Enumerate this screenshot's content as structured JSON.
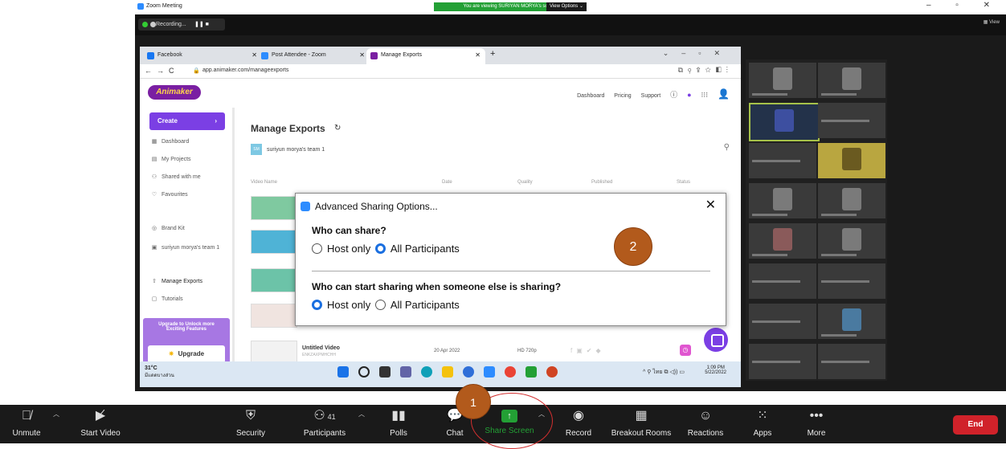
{
  "zoom_window": {
    "title": "Zoom Meeting",
    "viewing_banner": "You are viewing SURIYAN MORYA's screen",
    "view_options": "View Options ⌄",
    "recording_label": "Recording...",
    "rec_controls": "❚❚  ■",
    "view_label": "▦ View",
    "window_controls": "–  ▫  ✕"
  },
  "browser": {
    "tabs": [
      {
        "label": "Facebook",
        "icon_color": "#1877f2"
      },
      {
        "label": "Post Attendee - Zoom",
        "icon_color": "#2d8cff"
      },
      {
        "label": "Manage Exports",
        "icon_color": "#7a1fa2"
      }
    ],
    "tab_close": "✕",
    "new_tab": "+",
    "nav_icons": "←→C",
    "url": "app.animaker.com/manageexports"
  },
  "animaker": {
    "logo_text": "Animaker",
    "nav": [
      "Dashboard",
      "Pricing",
      "Support"
    ],
    "create_label": "Create",
    "sidebar_items": [
      "Dashboard",
      "My Projects",
      "Shared with me",
      "Favourites",
      "Brand Kit",
      "suriyun morya's team 1",
      "Manage Exports",
      "Tutorials"
    ],
    "upgrade_text": "Upgrade to Unlock more Exciting Features",
    "upgrade_button": "Upgrade",
    "page_title": "Manage Exports",
    "team_initials": "SM",
    "team_name": "suriyun morya's team 1",
    "columns": [
      "Video Name",
      "Date",
      "Quality",
      "Published",
      "Status"
    ],
    "last_row": {
      "name": "Untitled Video",
      "sub": "ENKZAXPMHCHH",
      "date": "20 Apr 2022",
      "quality": "HD 720p"
    }
  },
  "taskbar": {
    "temperature": "31°C",
    "weather_text": "มีแดดบางส่วน",
    "tray": "^  ⚲  ไทย  ⧉ ◁)) ▭",
    "time": "1:09 PM",
    "date": "5/22/2022"
  },
  "dialog": {
    "title": "Advanced Sharing Options...",
    "close": "✕",
    "q1": "Who can share?",
    "q1_options": [
      "Host only",
      "All Participants"
    ],
    "q1_selected": "All Participants",
    "q2": "Who can start sharing when someone else is sharing?",
    "q2_options": [
      "Host only",
      "All Participants"
    ],
    "q2_selected": "Host only"
  },
  "callouts": [
    "1",
    "2"
  ],
  "toolbar": {
    "unmute": "Unmute",
    "start_video": "Start Video",
    "security": "Security",
    "participants": "Participants",
    "participants_count": "41",
    "polls": "Polls",
    "chat": "Chat",
    "share_screen": "Share Screen",
    "record": "Record",
    "breakout_rooms": "Breakout Rooms",
    "reactions": "Reactions",
    "apps": "Apps",
    "more": "More",
    "end": "End",
    "share_color": "#23a035",
    "end_color": "#d0222a"
  }
}
